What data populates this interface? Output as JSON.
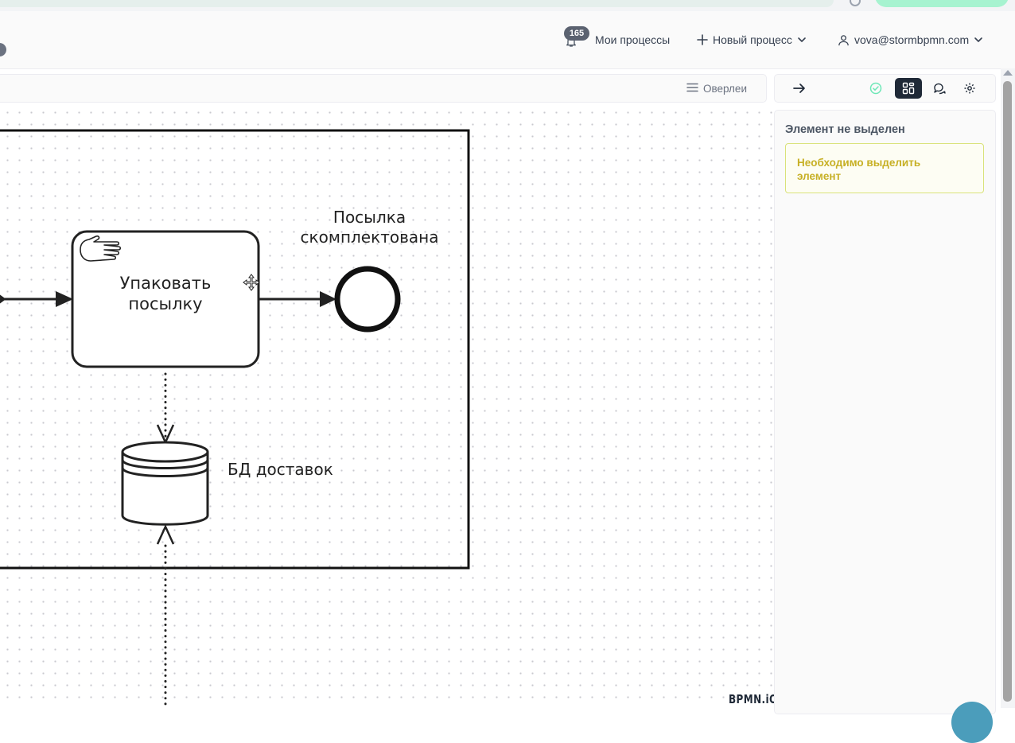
{
  "header": {
    "notifications_count": "165",
    "my_processes": "Мои процессы",
    "new_process": "Новый процесс",
    "user_email": "vova@stormbpmn.com"
  },
  "toolbar": {
    "overlays_label": "Оверлеи"
  },
  "diagram": {
    "task_label_line1": "Упаковать",
    "task_label_line2": "посылку",
    "end_event_label_line1": "Посылка",
    "end_event_label_line2": "скомплектована",
    "data_store_label": "БД доставок",
    "watermark": "BPMN.iO"
  },
  "panel": {
    "tabs": [
      "arrow-right-icon",
      "check-circle-icon",
      "layout-grid-icon",
      "comments-icon",
      "settings-icon"
    ],
    "active_tab": "layout-grid-icon",
    "title": "Элемент не выделен",
    "alert_line1": "Необходимо выделить",
    "alert_line2": "элемент"
  },
  "colors": {
    "accent_dark": "#1f2937",
    "alert_text": "#c7b025",
    "alert_border": "#d9e27a",
    "check_green": "#6ee7b7",
    "badge_bg": "#5b6270"
  }
}
